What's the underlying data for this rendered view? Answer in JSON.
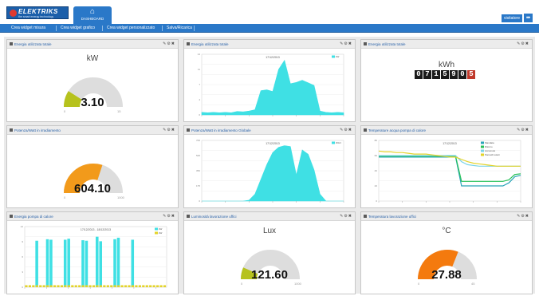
{
  "app": {
    "logo_text": "ELEKTRIKS",
    "logo_tagline": "the smart energy technology",
    "home_tab_label": "DASHBOARD",
    "user_label": "visitatore"
  },
  "toolbar": {
    "items": [
      "Crea widget misura",
      "Crea widget grafico",
      "Crea widget personalizzato",
      "Salva/Ricarica"
    ]
  },
  "panels": [
    {
      "title": "Energia utilizzata totale",
      "type": "gauge",
      "unit": "kW",
      "value": "3.10",
      "fraction": 0.18,
      "min": "0",
      "max": "15",
      "color": "#b6c21d",
      "value_size": 15
    },
    {
      "title": "Energia utilizzata totale",
      "type": "chart",
      "chart_ref": 0
    },
    {
      "title": "Energia utilizzata totale",
      "type": "counter",
      "unit": "kWh",
      "digits": [
        "0",
        "7",
        "1",
        "5",
        "9",
        "0",
        "5"
      ]
    },
    {
      "title": "Potenza/Watt in irradiamento",
      "type": "gauge",
      "unit": "",
      "value": "604.10",
      "fraction": 0.6,
      "min": "0",
      "max": "1000",
      "color": "#f29a1b",
      "value_size": 15
    },
    {
      "title": "Potenza/Watt in irradiamento Globale",
      "type": "chart",
      "chart_ref": 1
    },
    {
      "title": "Temperature acqua pompa di calore",
      "type": "chart",
      "chart_ref": 2
    },
    {
      "title": "Energia pompa di calore",
      "type": "chart",
      "chart_ref": 3
    },
    {
      "title": "Luminosità lavorazione uffici",
      "type": "gauge",
      "unit": "Lux",
      "value": "121.60",
      "fraction": 0.13,
      "min": "0",
      "max": "1000",
      "color": "#b6c21d",
      "value_size": 15
    },
    {
      "title": "Temperatura lavorazione uffici",
      "type": "gauge",
      "unit": "°C",
      "value": "27.88",
      "fraction": 0.62,
      "min": "0",
      "max": "45",
      "color": "#f47a0e",
      "value_size": 15
    }
  ],
  "chart_data": [
    {
      "type": "area",
      "title": "17/12/2013",
      "legend": [
        "kW"
      ],
      "colors": [
        "#3fe0e4"
      ],
      "ylim": [
        0,
        14
      ],
      "x": [
        0,
        1,
        2,
        3,
        4,
        5,
        6,
        7,
        8,
        9,
        10,
        11,
        12,
        13,
        14,
        15,
        16,
        17,
        18,
        19,
        20,
        21,
        22,
        23,
        24
      ],
      "series": [
        {
          "name": "kW",
          "values": [
            0.6,
            0.5,
            0.6,
            0.5,
            0.6,
            0.5,
            0.8,
            0.7,
            0.9,
            1.2,
            5.6,
            5.8,
            5.4,
            10.5,
            12.6,
            7.2,
            7.5,
            8.0,
            7.4,
            6.8,
            0.9,
            0.6,
            0.5,
            0.6,
            0.5
          ]
        }
      ]
    },
    {
      "type": "area",
      "title": "17/12/2013",
      "legend": [
        "W/m²"
      ],
      "colors": [
        "#3fe0e4"
      ],
      "ylim": [
        0,
        700
      ],
      "x": [
        0,
        1,
        2,
        3,
        4,
        5,
        6,
        7,
        8,
        9,
        10,
        11,
        12,
        13,
        14,
        15,
        16,
        17,
        18,
        19,
        20,
        21,
        22,
        23,
        24
      ],
      "series": [
        {
          "name": "W/m²",
          "values": [
            0,
            0,
            0,
            0,
            0,
            0,
            0,
            0,
            10,
            80,
            250,
            420,
            560,
            620,
            640,
            630,
            300,
            590,
            540,
            360,
            80,
            0,
            0,
            0,
            0
          ]
        }
      ]
    },
    {
      "type": "line",
      "title": "17/12/2013",
      "legend": [
        "Mandata",
        "Ritorno",
        "Accumulo",
        "Pannelli solari"
      ],
      "colors": [
        "#2aa5b8",
        "#29c25a",
        "#7bd4e8",
        "#e3d32a"
      ],
      "ylim": [
        0,
        80
      ],
      "x": [
        0,
        1,
        2,
        3,
        4,
        5,
        6,
        7,
        8,
        9,
        10,
        11,
        12,
        13,
        14,
        15,
        16,
        17,
        18,
        19,
        20,
        21,
        22,
        23,
        24
      ],
      "series": [
        {
          "name": "Mandata",
          "values": [
            58,
            58,
            58,
            58,
            58,
            58,
            58,
            58,
            58,
            58,
            58,
            58,
            58,
            58,
            20,
            20,
            20,
            20,
            20,
            20,
            20,
            20,
            24,
            32,
            34
          ]
        },
        {
          "name": "Ritorno",
          "values": [
            59,
            59,
            59,
            59,
            59,
            59,
            59,
            59,
            59,
            59,
            59,
            59,
            59,
            59,
            26,
            26,
            26,
            26,
            26,
            26,
            26,
            26,
            28,
            35,
            36
          ]
        },
        {
          "name": "Accumulo",
          "values": [
            60,
            60,
            60,
            60,
            60,
            60,
            60,
            60,
            60,
            60,
            60,
            60,
            60,
            60,
            52,
            48,
            47,
            46,
            46,
            46,
            46,
            46,
            46,
            46,
            46
          ]
        },
        {
          "name": "Pannelli solari",
          "values": [
            66,
            65,
            65,
            64,
            64,
            63,
            62,
            62,
            62,
            61,
            60,
            59,
            58,
            58,
            55,
            52,
            50,
            49,
            48,
            47,
            46,
            46,
            46,
            46,
            46
          ]
        }
      ]
    },
    {
      "type": "bar",
      "title": "17/12/2013 - 18/12/2013",
      "legend": [
        "kW",
        "kW"
      ],
      "colors": [
        "#3fe0e4",
        "#e3d32a"
      ],
      "ylim": [
        0,
        12
      ],
      "x": [
        0,
        1,
        2,
        3,
        4,
        5,
        6,
        7,
        8,
        9,
        10,
        11,
        12,
        13,
        14,
        15,
        16,
        17,
        18,
        19,
        20,
        21,
        22,
        23,
        24,
        25,
        26,
        27,
        28,
        29,
        30,
        31,
        32,
        33,
        34,
        35,
        36,
        37,
        38,
        39
      ],
      "series": [
        {
          "name": "kW",
          "values": [
            0,
            0,
            0,
            9.2,
            0,
            0,
            9.5,
            9.4,
            0,
            0,
            0,
            9.4,
            9.6,
            0,
            0,
            0,
            9.3,
            9.2,
            0,
            0,
            10.0,
            9.1,
            0,
            0,
            0,
            9.5,
            9.8,
            0,
            0,
            0,
            9.4,
            0,
            0,
            0,
            0,
            0,
            0,
            0,
            0,
            0
          ]
        },
        {
          "name": "kW",
          "values": [
            0.4,
            0.4,
            0.4,
            0.4,
            0.4,
            0.4,
            0.4,
            0.4,
            0.4,
            0.4,
            0.4,
            0.4,
            0.4,
            0.4,
            0.4,
            0.4,
            0.4,
            0.4,
            0.4,
            0.4,
            0.4,
            0.4,
            0.4,
            0.4,
            0.4,
            0.4,
            0.4,
            0.4,
            0.4,
            0.4,
            0.4,
            0.4,
            0.4,
            0.4,
            0.4,
            0.4,
            0.4,
            0.4,
            0.4,
            0.4
          ]
        }
      ]
    }
  ]
}
